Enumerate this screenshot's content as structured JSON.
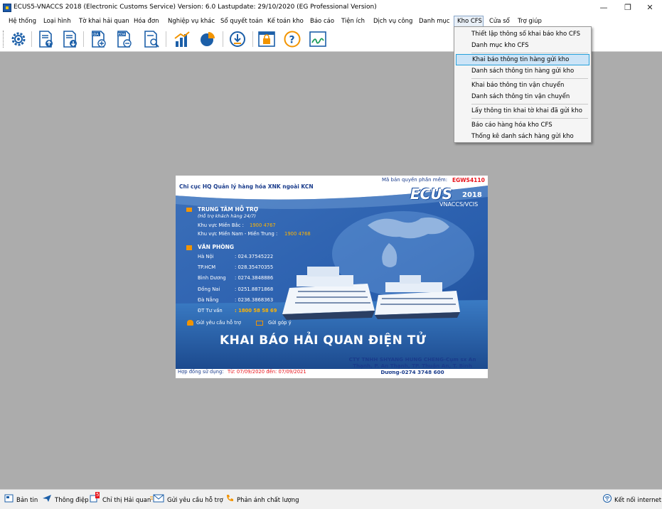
{
  "window": {
    "title": "ECUS5-VNACCS 2018 (Electronic Customs Service) Version: 6.0 Lastupdate: 29/10/2020 (EG Professional Version)",
    "minimize": "—",
    "restore": "❐",
    "close": "✕"
  },
  "menu": [
    {
      "label": "Hệ thống"
    },
    {
      "label": "Loại hình"
    },
    {
      "label": "Tờ khai hải quan"
    },
    {
      "label": "Hóa đơn"
    },
    {
      "label": "Nghiệp vụ khác"
    },
    {
      "label": "Sổ quyết toán"
    },
    {
      "label": "Kế toán kho"
    },
    {
      "label": "Báo cáo"
    },
    {
      "label": "Tiện ích"
    },
    {
      "label": "Dịch vụ công"
    },
    {
      "label": "Danh mục"
    },
    {
      "label": "Kho CFS"
    },
    {
      "label": "Cửa sổ"
    },
    {
      "label": "Trợ giúp"
    }
  ],
  "toolbar_icons": [
    "gear-icon",
    "document-upload-icon",
    "document-download-icon",
    "ida-add-icon",
    "eda-remove-icon",
    "document-search-icon",
    "bar-chart-icon",
    "pie-chart-icon",
    "download-icon",
    "lock-icon",
    "help-icon",
    "signature-icon"
  ],
  "dropdown": {
    "items": [
      {
        "label": "Thiết lập thông số khai báo kho CFS"
      },
      {
        "label": "Danh mục kho CFS"
      },
      {
        "label": "Khai báo thông tin hàng gửi kho"
      },
      {
        "label": "Danh sách thông tin hàng gửi kho"
      },
      {
        "label": "Khai báo thông tin vận chuyển"
      },
      {
        "label": "Danh sách thông tin vận chuyển"
      },
      {
        "label": "Lấy thông tin khai tờ khai đã gửi kho"
      },
      {
        "label": "Báo cáo hàng hóa kho CFS"
      },
      {
        "label": "Thống kê danh sách hàng gửi kho"
      }
    ],
    "highlighted": "Khai báo thông tin hàng gửi kho"
  },
  "splash": {
    "agency": "Chi cục HQ Quản lý hàng hóa XNK ngoài KCN",
    "license_label": "Mã bản quyền phần mềm:",
    "license_code": "EGWS4110",
    "logo": "ECUS",
    "logo_year": "2018",
    "logo_sub": "VNACCS/VCIS",
    "support_title": "TRUNG TÂM HỖ TRỢ",
    "support_sub": "(Hỗ trợ khách hàng 24/7)",
    "north_label": "Khu vực Miền Bắc :",
    "north_phone": "1900 4767",
    "south_label": "Khu vực Miền Nam - Miền Trung :",
    "south_phone": "1900 4768",
    "office_title": "VĂN PHÒNG",
    "offices": [
      {
        "city": "Hà Nội",
        "phone": ": 024.37545222"
      },
      {
        "city": "TP.HCM",
        "phone": ": 028.35470355"
      },
      {
        "city": "Bình Dương",
        "phone": ": 0274.3848886"
      },
      {
        "city": "Đồng Nai",
        "phone": ": 0251.8871868"
      },
      {
        "city": "Đà Nẵng",
        "phone": ": 0236.3868363"
      },
      {
        "city": "ĐT Tư vấn",
        "phone": ": 1800 58 58 69"
      }
    ],
    "request_support": "Gửi yêu cầu hỗ trợ",
    "feedback": "Gửi góp ý",
    "headline": "KHAI BÁO HẢI QUAN ĐIỆN TỬ",
    "company_line1": "CTY TNHH SHYANG HUNG CHENG-Cụm sx An",
    "company_line2": "Thạnh, P. An Thạnh, TP. Thuận An, T. Bình",
    "company_line3": "Dương-0274 3748 600",
    "contract_label": "Hợp đồng sử dụng:",
    "contract_period": "Từ: 07/09/2020 đến: 07/09/2021"
  },
  "statusbar": {
    "news": "Bản tin",
    "messages": "Thông điệp",
    "directive": "Chỉ thị Hải quan",
    "directive_badge": "5",
    "support": "Gửi yêu cầu hỗ trợ",
    "quality": "Phản ánh chất lượng",
    "internet": "Kết nối internet"
  },
  "colors": {
    "accent_orange": "#ff9c1a",
    "license_red": "#e8141c",
    "splash_blue": "#2a5fae",
    "menu_highlight": "#cce4f7"
  }
}
